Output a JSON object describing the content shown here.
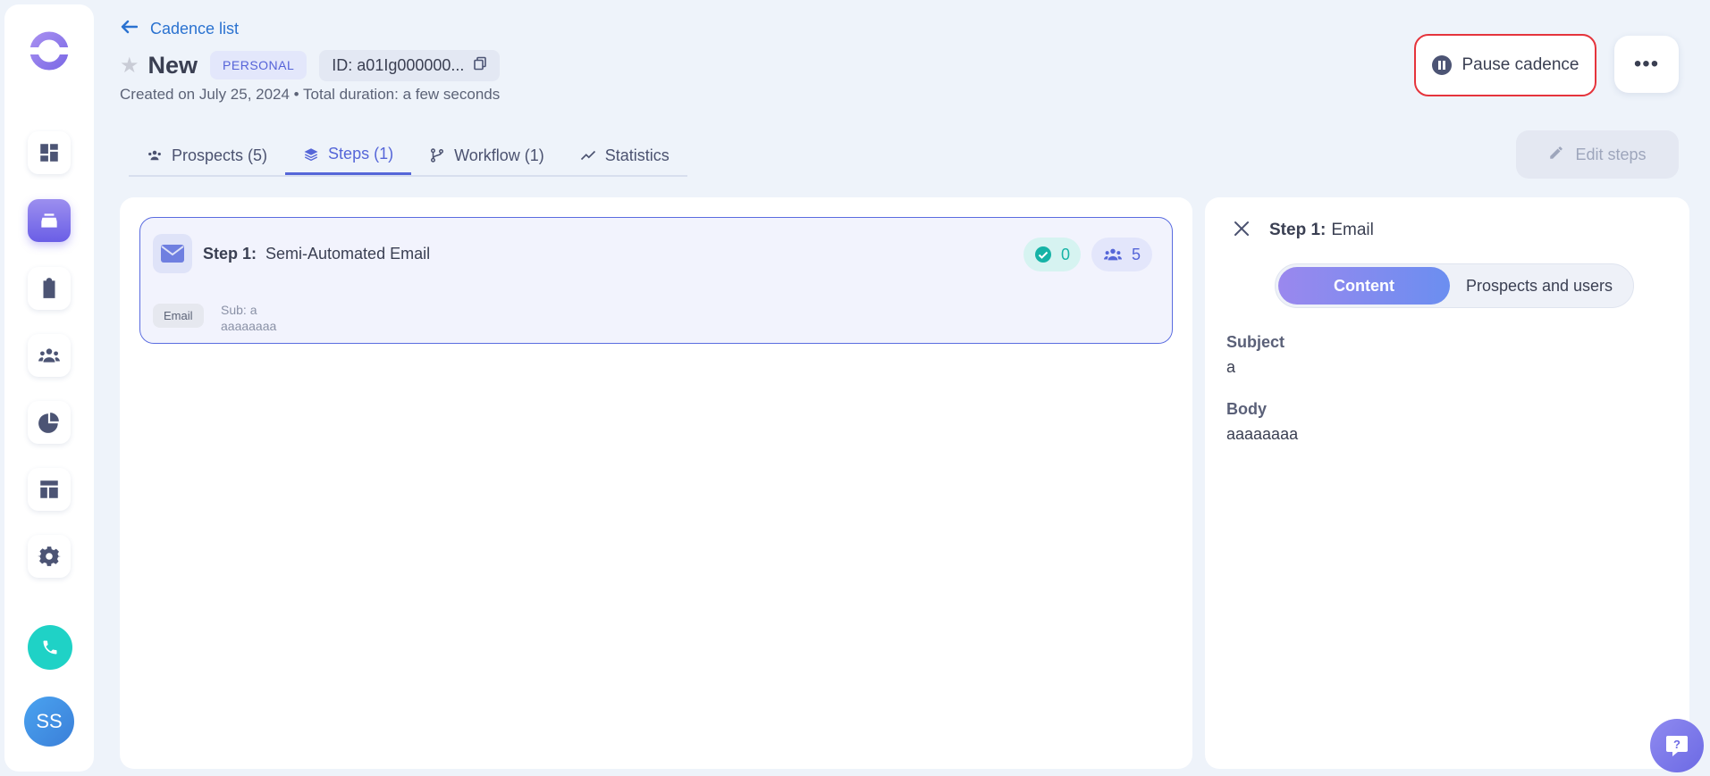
{
  "nav": {
    "back_label": "Cadence list",
    "items": [
      "dashboard",
      "cadences",
      "tasks",
      "people",
      "reports",
      "templates",
      "settings"
    ]
  },
  "header": {
    "title": "New",
    "badge": "PERSONAL",
    "id_label": "ID: a01Ig000000...",
    "subtitle": "Created on July 25, 2024 • Total duration: a few seconds",
    "pause_label": "Pause cadence",
    "more_label": "•••"
  },
  "tabs": [
    {
      "label": "Prospects (5)"
    },
    {
      "label": "Steps (1)"
    },
    {
      "label": "Workflow (1)"
    },
    {
      "label": "Statistics"
    }
  ],
  "edit_steps_label": "Edit steps",
  "step": {
    "number_label": "Step 1:",
    "name": "Semi-Automated Email",
    "done_count": "0",
    "people_count": "5",
    "type_tag": "Email",
    "sub_line1": "Sub: a",
    "sub_line2": "aaaaaaaa"
  },
  "side_panel": {
    "step_label": "Step 1:",
    "step_type": "Email",
    "seg_content": "Content",
    "seg_prospects": "Prospects and users",
    "subject_label": "Subject",
    "subject_value": "a",
    "body_label": "Body",
    "body_value": "aaaaaaaa"
  },
  "user": {
    "initials": "SS"
  },
  "colors": {
    "accent": "#5566d8",
    "pause_outline": "#e5343c",
    "teal": "#1fd2c6"
  }
}
